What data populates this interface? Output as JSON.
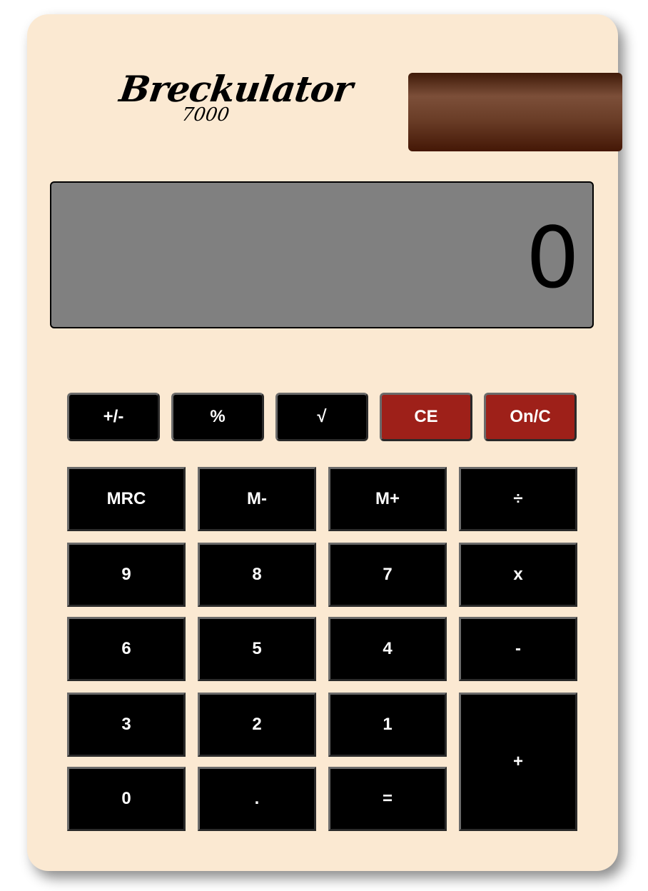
{
  "brand": {
    "name": "Breckulator",
    "model": "7000"
  },
  "display": {
    "value": "0"
  },
  "colors": {
    "body": "#fbe9d2",
    "display": "#808080",
    "key": "#000000",
    "key_red": "#9e2019",
    "solar_panel": "#6a3d27"
  },
  "top_keys": {
    "negate": "+/-",
    "percent": "%",
    "sqrt": "√",
    "clear_entry": "CE",
    "on_clear": "On/C"
  },
  "keys": {
    "mrc": "MRC",
    "m_minus": "M-",
    "m_plus": "M+",
    "divide": "÷",
    "nine": "9",
    "eight": "8",
    "seven": "7",
    "multiply": "x",
    "six": "6",
    "five": "5",
    "four": "4",
    "subtract": "-",
    "three": "3",
    "two": "2",
    "one": "1",
    "add": "+",
    "zero": "0",
    "decimal": ".",
    "equals": "="
  }
}
